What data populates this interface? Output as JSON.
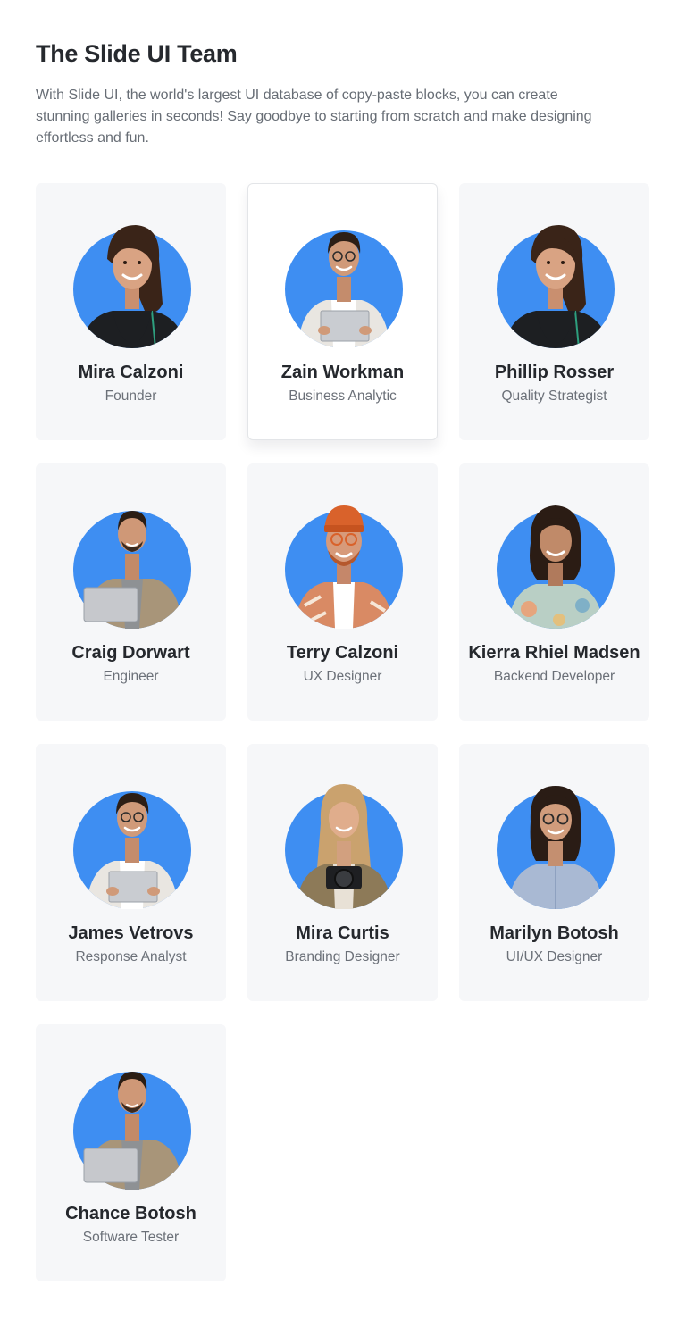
{
  "header": {
    "title": "The Slide UI Team",
    "description": "With Slide UI, the world's largest UI database of copy-paste blocks, you can create stunning galleries in seconds! Say goodbye to starting from scratch and make designing effortless and fun."
  },
  "colors": {
    "accent": "#3e8ef2",
    "card_bg": "#f6f7f9"
  },
  "team": [
    {
      "name": "Mira Calzoni",
      "role": "Founder",
      "avatar": "woman-dark-hair-black-shirt",
      "active": false
    },
    {
      "name": "Zain Workman",
      "role": "Business Analytic",
      "avatar": "man-glasses-laptop",
      "active": true
    },
    {
      "name": "Phillip Rosser",
      "role": "Quality Strategist",
      "avatar": "woman-dark-hair-black-shirt",
      "active": false
    },
    {
      "name": "Craig Dorwart",
      "role": "Engineer",
      "avatar": "man-beige-jacket-laptop",
      "active": false
    },
    {
      "name": "Terry Calzoni",
      "role": "UX Designer",
      "avatar": "man-orange-beanie",
      "active": false
    },
    {
      "name": "Kierra Rhiel Madsen",
      "role": "Backend Developer",
      "avatar": "woman-curly-hair-floral",
      "active": false
    },
    {
      "name": "James Vetrovs",
      "role": "Response Analyst",
      "avatar": "man-glasses-laptop",
      "active": false
    },
    {
      "name": "Mira Curtis",
      "role": "Branding Designer",
      "avatar": "woman-blonde-camera",
      "active": false
    },
    {
      "name": "Marilyn Botosh",
      "role": "UI/UX Designer",
      "avatar": "woman-glasses-blue-shirt",
      "active": false
    },
    {
      "name": "Chance Botosh",
      "role": "Software Tester",
      "avatar": "man-beige-jacket-laptop",
      "active": false
    }
  ]
}
